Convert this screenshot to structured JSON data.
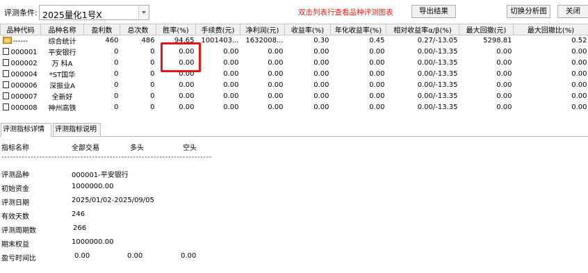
{
  "toolbar": {
    "condition_label": "评测条件:",
    "condition_value": "2025量化1号X",
    "hint": "双击列表行查看品种评测图表",
    "export_label": "导出结果",
    "switch_label": "切换分析图",
    "close_label": "关闭"
  },
  "table": {
    "headers": [
      "品种代码",
      "品种名称",
      "盈利数",
      "总次数",
      "胜率(%)",
      "手续费(元)",
      "净利润(元)",
      "收益率(%)",
      "年化收益率(%)",
      "相对收益率α/β(%)",
      "最大回撤(元)",
      "最大回撤比(%)"
    ],
    "rows": [
      {
        "code": "------",
        "name": "综合统计",
        "win": "460",
        "total": "486",
        "winrate": "94.65",
        "fee": "1001403...",
        "profit": "1632008...",
        "ret": "0.30",
        "annual": "0.45",
        "alpha": "0.27/-13.05",
        "maxdd": "5298.81",
        "maxddr": "0.52"
      },
      {
        "code": "000001",
        "name": "平安银行",
        "win": "0",
        "total": "0",
        "winrate": "0.00",
        "fee": "0.00",
        "profit": "0.00",
        "ret": "0.00",
        "annual": "0.00",
        "alpha": "0.00/-13.35",
        "maxdd": "0.00",
        "maxddr": "0.00"
      },
      {
        "code": "000002",
        "name": "万 科A",
        "win": "0",
        "total": "0",
        "winrate": "0.00",
        "fee": "0.00",
        "profit": "0.00",
        "ret": "0.00",
        "annual": "0.00",
        "alpha": "0.00/-13.35",
        "maxdd": "0.00",
        "maxddr": "0.00"
      },
      {
        "code": "000004",
        "name": "*ST国华",
        "win": "0",
        "total": "0",
        "winrate": "0.00",
        "fee": "0.00",
        "profit": "0.00",
        "ret": "0.00",
        "annual": "0.00",
        "alpha": "0.00/-13.35",
        "maxdd": "0.00",
        "maxddr": "0.00"
      },
      {
        "code": "000006",
        "name": "深振业A",
        "win": "0",
        "total": "0",
        "winrate": "0.00",
        "fee": "0.00",
        "profit": "0.00",
        "ret": "0.00",
        "annual": "0.00",
        "alpha": "0.00/-13.35",
        "maxdd": "0.00",
        "maxddr": "0.00"
      },
      {
        "code": "000007",
        "name": "全新好",
        "win": "0",
        "total": "0",
        "winrate": "0.00",
        "fee": "0.00",
        "profit": "0.00",
        "ret": "0.00",
        "annual": "0.00",
        "alpha": "0.00/-13.35",
        "maxdd": "0.00",
        "maxddr": "0.00"
      },
      {
        "code": "000008",
        "name": "神州高铁",
        "win": "0",
        "total": "0",
        "winrate": "0.00",
        "fee": "0.00",
        "profit": "0.00",
        "ret": "0.00",
        "annual": "0.00",
        "alpha": "0.00/-13.35",
        "maxdd": "0.00",
        "maxddr": "0.00"
      }
    ]
  },
  "tabs": [
    "评测指标详情",
    "评测指标说明"
  ],
  "detail": {
    "header": {
      "name": "指标名称",
      "all": "全部交易",
      "long": "多头",
      "short": "空头"
    },
    "divider": "------------------------------------------------------------------------",
    "items": [
      {
        "label": "评测品种",
        "value": "000001-平安银行"
      },
      {
        "label": "初始资金",
        "value": "1000000.00"
      },
      {
        "label": "评测日期",
        "value": "2025/01/02-2025/09/05"
      },
      {
        "label": "有效天数",
        "value": "246"
      },
      {
        "label": "评测周期数",
        "value": "266"
      },
      {
        "label": "期末权益",
        "value": "1000000.00"
      }
    ],
    "ratio": {
      "label": "盈亏时间比",
      "all": "0.00",
      "long": "0.00",
      "short": "0.00"
    }
  },
  "colors": {
    "hint": "#e0211a",
    "highlight": "#e4141b",
    "header_bg": "#f0f0f0"
  },
  "icons": {
    "summary_row": "folder-icon",
    "stock_row": "document-icon",
    "combo": "chevron-down-icon"
  }
}
